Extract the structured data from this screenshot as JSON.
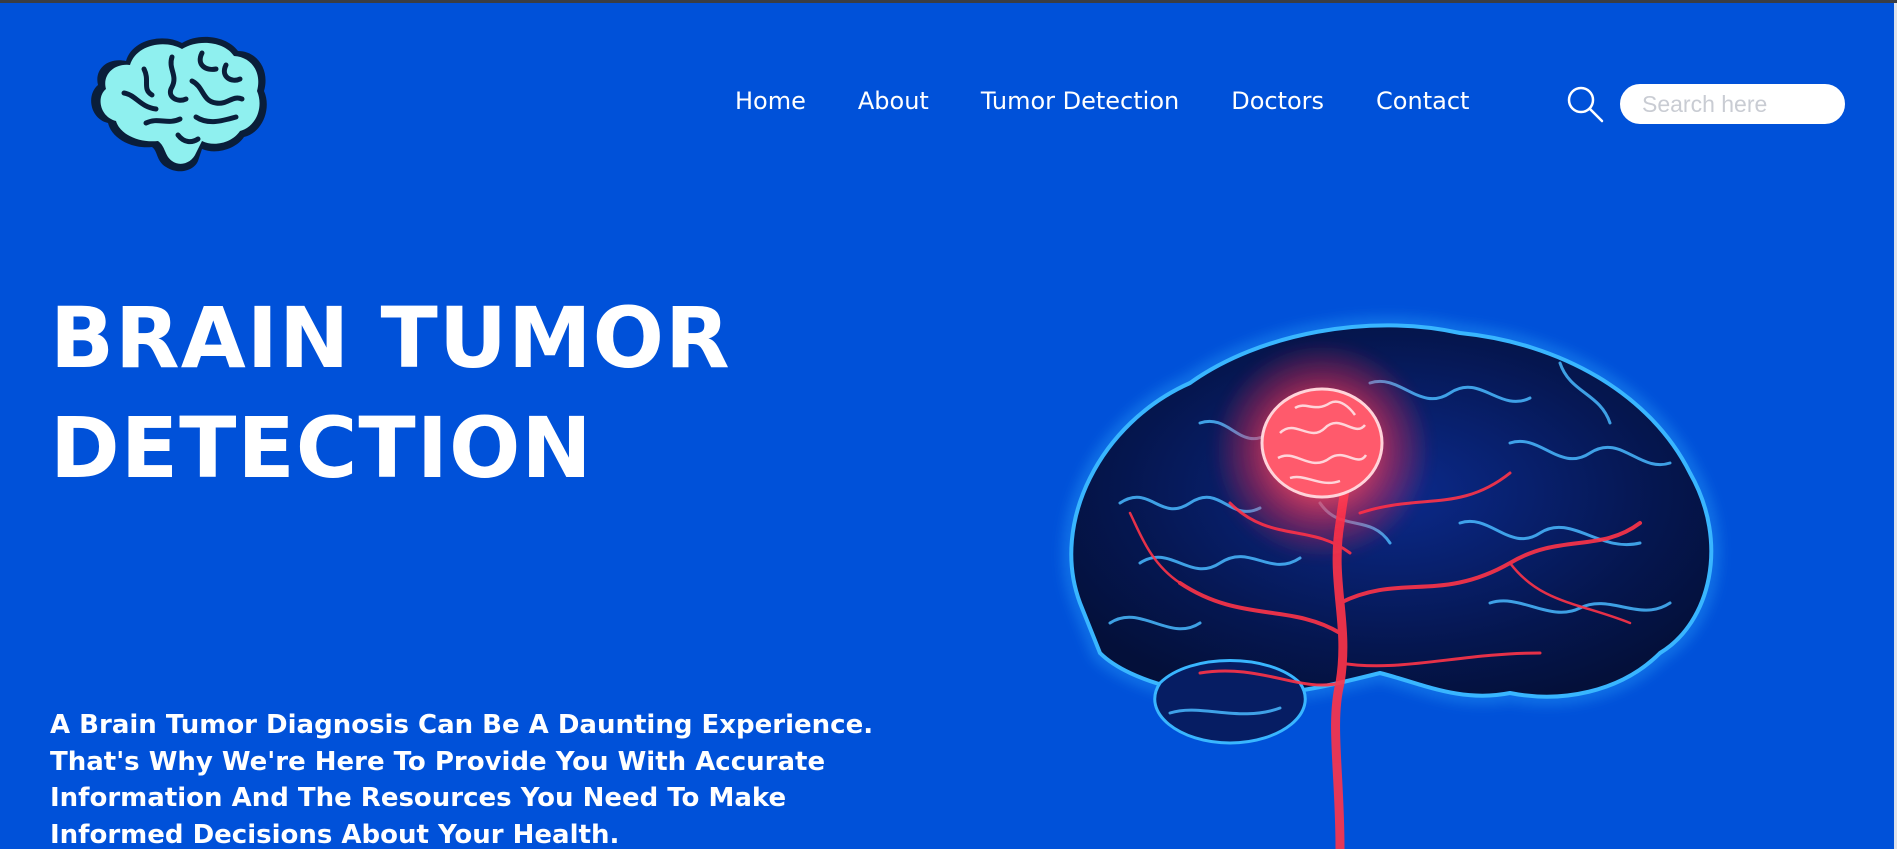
{
  "header": {
    "logo_icon": "brain-logo-icon",
    "nav": [
      {
        "label": "Home"
      },
      {
        "label": "About"
      },
      {
        "label": "Tumor Detection"
      },
      {
        "label": "Doctors"
      },
      {
        "label": "Contact"
      }
    ],
    "search": {
      "icon": "search-icon",
      "placeholder": "Search here",
      "value": ""
    }
  },
  "hero": {
    "title_lines": [
      "BRAIN TUMOR",
      "DETECTION"
    ],
    "description_lines": [
      "A Brain Tumor Diagnosis Can Be A Daunting Experience.",
      "That's Why We're Here To Provide You With Accurate",
      "Information And The Resources You Need To Make",
      "Informed Decisions About Your Health."
    ],
    "illustration": "glowing-brain-tumor-illustration"
  },
  "colors": {
    "background": "#0051d9",
    "text": "#ffffff",
    "logo_fill": "#8ff0ef",
    "tumor_glow": "#ff3b4e"
  }
}
